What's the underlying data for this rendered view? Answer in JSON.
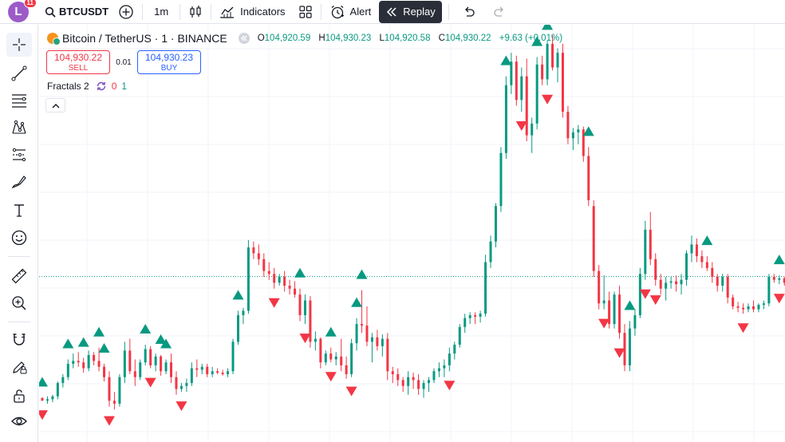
{
  "user": {
    "avatar_letter": "L",
    "notifications": "11"
  },
  "topbar": {
    "symbol": "BTCUSDT",
    "interval": "1m",
    "indicators_label": "Indicators",
    "alert_label": "Alert",
    "replay_label": "Replay"
  },
  "legend": {
    "title": "Bitcoin / TetherUS · 1 · BINANCE",
    "o_label": "O",
    "o_value": "104,920.59",
    "h_label": "H",
    "h_value": "104,930.23",
    "l_label": "L",
    "l_value": "104,920.58",
    "c_label": "C",
    "c_value": "104,930.22",
    "change": "+9.63 (+0.01%)"
  },
  "trade": {
    "sell_price": "104,930.22",
    "sell_label": "SELL",
    "spread": "0.01",
    "buy_price": "104,930.23",
    "buy_label": "BUY"
  },
  "indicator": {
    "name": "Fractals 2",
    "value_down": "0",
    "value_up": "1"
  },
  "colors": {
    "up": "#089981",
    "down": "#f23645",
    "accent": "#2962ff",
    "price_line": "#089981"
  },
  "chart_data": {
    "type": "candlestick",
    "price_line": 104930.22,
    "candles": [
      [
        104848,
        104848,
        104846,
        104846
      ],
      [
        104846,
        104849,
        104844,
        104847
      ],
      [
        104847,
        104850,
        104845,
        104849
      ],
      [
        104849,
        104859,
        104847,
        104858
      ],
      [
        104858,
        104864,
        104855,
        104862
      ],
      [
        104862,
        104874,
        104860,
        104871
      ],
      [
        104871,
        104878,
        104868,
        104873
      ],
      [
        104873,
        104879,
        104869,
        104872
      ],
      [
        104872,
        104875,
        104865,
        104868
      ],
      [
        104868,
        104880,
        104866,
        104877
      ],
      [
        104877,
        104879,
        104870,
        104873
      ],
      [
        104873,
        104882,
        104866,
        104869
      ],
      [
        104869,
        104871,
        104859,
        104862
      ],
      [
        104862,
        104866,
        104842,
        104846
      ],
      [
        104846,
        104852,
        104840,
        104844
      ],
      [
        104844,
        104864,
        104842,
        104862
      ],
      [
        104862,
        104886,
        104858,
        104880
      ],
      [
        104880,
        104888,
        104864,
        104866
      ],
      [
        104866,
        104874,
        104856,
        104862
      ],
      [
        104862,
        104874,
        104860,
        104872
      ],
      [
        104872,
        104884,
        104870,
        104881
      ],
      [
        104881,
        104883,
        104868,
        104870
      ],
      [
        104870,
        104878,
        104866,
        104876
      ],
      [
        104876,
        104877,
        104863,
        104866
      ],
      [
        104866,
        104874,
        104864,
        104872
      ],
      [
        104872,
        104878,
        104858,
        104862
      ],
      [
        104862,
        104866,
        104850,
        104854
      ],
      [
        104854,
        104858,
        104852,
        104856
      ],
      [
        104856,
        104861,
        104852,
        104858
      ],
      [
        104858,
        104872,
        104856,
        104868
      ],
      [
        104868,
        104874,
        104862,
        104867
      ],
      [
        104867,
        104871,
        104864,
        104869
      ],
      [
        104869,
        104871,
        104862,
        104864
      ],
      [
        104864,
        104869,
        104862,
        104866
      ],
      [
        104866,
        104868,
        104864,
        104865
      ],
      [
        104865,
        104867,
        104863,
        104864
      ],
      [
        104864,
        104868,
        104862,
        104866
      ],
      [
        104866,
        104888,
        104864,
        104886
      ],
      [
        104886,
        104907,
        104884,
        104904
      ],
      [
        104904,
        104909,
        104898,
        104907
      ],
      [
        104907,
        104955,
        104905,
        104950
      ],
      [
        104950,
        104954,
        104942,
        104946
      ],
      [
        104946,
        104952,
        104938,
        104942
      ],
      [
        104942,
        104946,
        104930,
        104934
      ],
      [
        104934,
        104940,
        104928,
        104932
      ],
      [
        104932,
        104936,
        104922,
        104926
      ],
      [
        104926,
        104932,
        104924,
        104930
      ],
      [
        104930,
        104934,
        104920,
        104924
      ],
      [
        104924,
        104928,
        104918,
        104922
      ],
      [
        104922,
        104927,
        104916,
        104918
      ],
      [
        104918,
        104922,
        104900,
        104904
      ],
      [
        104904,
        104918,
        104898,
        104914
      ],
      [
        104914,
        104917,
        104882,
        104886
      ],
      [
        104886,
        104893,
        104880,
        104888
      ],
      [
        104888,
        104889,
        104868,
        104872
      ],
      [
        104872,
        104880,
        104870,
        104878
      ],
      [
        104878,
        104882,
        104872,
        104874
      ],
      [
        104874,
        104879,
        104870,
        104876
      ],
      [
        104876,
        104888,
        104866,
        104870
      ],
      [
        104870,
        104876,
        104861,
        104864
      ],
      [
        104864,
        104888,
        104862,
        104885
      ],
      [
        104885,
        104902,
        104880,
        104898
      ],
      [
        104898,
        104921,
        104892,
        104897
      ],
      [
        104897,
        104910,
        104883,
        104886
      ],
      [
        104886,
        104892,
        104872,
        104889
      ],
      [
        104889,
        104894,
        104880,
        104883
      ],
      [
        104883,
        104891,
        104876,
        104888
      ],
      [
        104888,
        104892,
        104860,
        104866
      ],
      [
        104866,
        104869,
        104858,
        104864
      ],
      [
        104864,
        104868,
        104856,
        104860
      ],
      [
        104860,
        104862,
        104852,
        104856
      ],
      [
        104856,
        104866,
        104850,
        104862
      ],
      [
        104862,
        104865,
        104854,
        104860
      ],
      [
        104860,
        104864,
        104850,
        104854
      ],
      [
        104854,
        104860,
        104848,
        104858
      ],
      [
        104858,
        104862,
        104852,
        104860
      ],
      [
        104860,
        104868,
        104858,
        104866
      ],
      [
        104866,
        104872,
        104862,
        104868
      ],
      [
        104868,
        104874,
        104862,
        104870
      ],
      [
        104870,
        104882,
        104866,
        104878
      ],
      [
        104878,
        104886,
        104874,
        104884
      ],
      [
        104884,
        104898,
        104882,
        104896
      ],
      [
        104896,
        104905,
        104892,
        104902
      ],
      [
        104902,
        104906,
        104898,
        104904
      ],
      [
        104904,
        104906,
        104898,
        104903
      ],
      [
        104903,
        104907,
        104899,
        104905
      ],
      [
        104905,
        104945,
        104903,
        104940
      ],
      [
        104940,
        104958,
        104936,
        104954
      ],
      [
        104954,
        104980,
        104950,
        104978
      ],
      [
        104978,
        105018,
        104974,
        105014
      ],
      [
        105014,
        105066,
        105010,
        105060
      ],
      [
        105060,
        105082,
        105054,
        105076
      ],
      [
        105076,
        105080,
        105046,
        105050
      ],
      [
        105050,
        105072,
        105042,
        105066
      ],
      [
        105066,
        105078,
        105022,
        105026
      ],
      [
        105026,
        105038,
        105014,
        105034
      ],
      [
        105034,
        105079,
        105030,
        105074
      ],
      [
        105074,
        105080,
        105060,
        105064
      ],
      [
        105064,
        105090,
        105060,
        105088
      ],
      [
        105088,
        105094,
        105070,
        105072
      ],
      [
        105072,
        105085,
        105062,
        105082
      ],
      [
        105082,
        105088,
        105038,
        105042
      ],
      [
        105042,
        105046,
        105020,
        105024
      ],
      [
        105024,
        105031,
        105016,
        105028
      ],
      [
        105028,
        105033,
        105020,
        105030
      ],
      [
        105030,
        105032,
        105008,
        105012
      ],
      [
        105012,
        105018,
        104978,
        104982
      ],
      [
        104978,
        104982,
        104930,
        104934
      ],
      [
        104934,
        104938,
        104908,
        104912
      ],
      [
        104912,
        104931,
        104908,
        104914
      ],
      [
        104914,
        104920,
        104895,
        104898
      ],
      [
        104898,
        104920,
        104895,
        104918
      ],
      [
        104918,
        104924,
        104888,
        104892
      ],
      [
        104892,
        104898,
        104866,
        104870
      ],
      [
        104870,
        104900,
        104866,
        104895
      ],
      [
        104895,
        104908,
        104890,
        104904
      ],
      [
        104904,
        104936,
        104902,
        104932
      ],
      [
        104932,
        104968,
        104928,
        104962
      ],
      [
        104962,
        104974,
        104938,
        104942
      ],
      [
        104942,
        104946,
        104924,
        104928
      ],
      [
        104928,
        104932,
        104918,
        104922
      ],
      [
        104922,
        104930,
        104914,
        104926
      ],
      [
        104926,
        104930,
        104922,
        104927
      ],
      [
        104927,
        104931,
        104920,
        104925
      ],
      [
        104925,
        104932,
        104918,
        104928
      ],
      [
        104928,
        104948,
        104924,
        104946
      ],
      [
        104946,
        104958,
        104940,
        104952
      ],
      [
        104952,
        104956,
        104940,
        104944
      ],
      [
        104944,
        104948,
        104936,
        104940
      ],
      [
        104940,
        104944,
        104934,
        104936
      ],
      [
        104936,
        104940,
        104926,
        104930
      ],
      [
        104930,
        104932,
        104920,
        104924
      ],
      [
        104924,
        104932,
        104920,
        104930
      ],
      [
        104930,
        104932,
        104912,
        104916
      ],
      [
        104916,
        104918,
        104908,
        104910
      ],
      [
        104910,
        104913,
        104906,
        104909
      ],
      [
        104909,
        104912,
        104905,
        104908
      ],
      [
        104908,
        104912,
        104906,
        104910
      ],
      [
        104910,
        104914,
        104906,
        104908
      ],
      [
        104908,
        104912,
        104906,
        104911
      ],
      [
        104911,
        104914,
        104908,
        104912
      ],
      [
        104912,
        104932,
        104910,
        104930
      ],
      [
        104930,
        104932,
        104926,
        104928
      ],
      [
        104928,
        104931,
        104925,
        104929
      ],
      [
        104929,
        104930,
        104924,
        104926
      ],
      [
        104926,
        104928,
        104908,
        104910
      ],
      [
        104910,
        104929,
        104908,
        104927
      ],
      [
        104927,
        104929,
        104895,
        104898
      ],
      [
        104898,
        104900,
        104896,
        104897
      ]
    ],
    "fractals_up": [
      0,
      5,
      8,
      11,
      12,
      20,
      23,
      24,
      38,
      50,
      56,
      61,
      62,
      90,
      96,
      98,
      106,
      114,
      129,
      143
    ],
    "fractals_down": [
      0,
      13,
      21,
      27,
      45,
      51,
      56,
      60,
      79,
      93,
      98,
      109,
      112,
      117,
      119,
      136,
      143
    ]
  }
}
